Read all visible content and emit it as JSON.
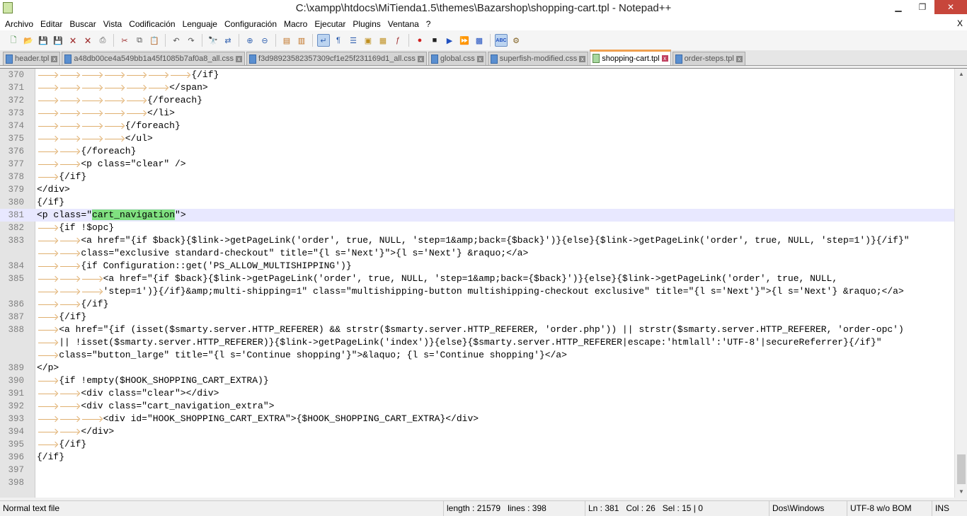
{
  "window": {
    "title": "C:\\xampp\\htdocs\\MiTienda1.5\\themes\\Bazarshop\\shopping-cart.tpl - Notepad++",
    "minimize": "▁",
    "maximize": "❐",
    "close": "✕"
  },
  "menu": [
    "Archivo",
    "Editar",
    "Buscar",
    "Vista",
    "Codificación",
    "Lenguaje",
    "Configuración",
    "Macro",
    "Ejecutar",
    "Plugins",
    "Ventana",
    "?"
  ],
  "menu_close": "X",
  "toolbar": [
    {
      "name": "new-file",
      "glyph": "🗋",
      "color": "#2a7a2a"
    },
    {
      "name": "open-file",
      "glyph": "📂",
      "color": "#c09020"
    },
    {
      "name": "save",
      "glyph": "💾",
      "color": "#3050a0"
    },
    {
      "name": "save-all",
      "glyph": "💾",
      "color": "#3050a0"
    },
    {
      "name": "close",
      "glyph": "🗙",
      "color": "#a03030"
    },
    {
      "name": "close-all",
      "glyph": "🗙",
      "color": "#a03030"
    },
    {
      "name": "print",
      "glyph": "⎙",
      "color": "#555"
    },
    {
      "sep": true
    },
    {
      "name": "cut",
      "glyph": "✂",
      "color": "#a03030"
    },
    {
      "name": "copy",
      "glyph": "⧉",
      "color": "#555"
    },
    {
      "name": "paste",
      "glyph": "📋",
      "color": "#555"
    },
    {
      "sep": true
    },
    {
      "name": "undo",
      "glyph": "↶",
      "color": "#555"
    },
    {
      "name": "redo",
      "glyph": "↷",
      "color": "#555"
    },
    {
      "sep": true
    },
    {
      "name": "find",
      "glyph": "🔭",
      "color": "#333"
    },
    {
      "name": "replace",
      "glyph": "⇄",
      "color": "#3060b0"
    },
    {
      "sep": true
    },
    {
      "name": "zoom-in",
      "glyph": "⊕",
      "color": "#3060b0"
    },
    {
      "name": "zoom-out",
      "glyph": "⊖",
      "color": "#3060b0"
    },
    {
      "sep": true
    },
    {
      "name": "sync-vertical",
      "glyph": "▤",
      "color": "#c07020"
    },
    {
      "name": "sync-horizontal",
      "glyph": "▥",
      "color": "#c07020"
    },
    {
      "sep": true
    },
    {
      "name": "word-wrap",
      "glyph": "↵",
      "color": "#3060b0",
      "active": true
    },
    {
      "name": "show-all-chars",
      "glyph": "¶",
      "color": "#3060b0"
    },
    {
      "name": "indent-guide",
      "glyph": "☰",
      "color": "#3060b0"
    },
    {
      "name": "define-language",
      "glyph": "▣",
      "color": "#c09020"
    },
    {
      "name": "doc-map",
      "glyph": "▦",
      "color": "#c09020"
    },
    {
      "name": "function-list",
      "glyph": "ƒ",
      "color": "#a03030"
    },
    {
      "sep": true
    },
    {
      "name": "record-macro",
      "glyph": "●",
      "color": "#d02020"
    },
    {
      "name": "stop-record",
      "glyph": "■",
      "color": "#222"
    },
    {
      "name": "play-macro",
      "glyph": "▶",
      "color": "#2050c0"
    },
    {
      "name": "run-macro-multiple",
      "glyph": "⏩",
      "color": "#2050c0"
    },
    {
      "name": "save-macro",
      "glyph": "▩",
      "color": "#2050c0"
    },
    {
      "sep": true
    },
    {
      "name": "spell-check",
      "glyph": "ABC",
      "color": "#2050c0",
      "active": true
    },
    {
      "name": "spell-options",
      "glyph": "⚙",
      "color": "#806020"
    }
  ],
  "tabs": [
    {
      "label": "header.tpl",
      "active": false
    },
    {
      "label": "a48db00ce4a549bb1a45f1085b7af0a8_all.css",
      "active": false
    },
    {
      "label": "f3d98923582357309cf1e25f231169d1_all.css",
      "active": false
    },
    {
      "label": "global.css",
      "active": false
    },
    {
      "label": "superfish-modified.css",
      "active": false
    },
    {
      "label": "shopping-cart.tpl",
      "active": true
    },
    {
      "label": "order-steps.tpl",
      "active": false
    }
  ],
  "code": [
    {
      "n": "370",
      "indent": 7,
      "text": "{/if}"
    },
    {
      "n": "371",
      "indent": 6,
      "text": "</span>"
    },
    {
      "n": "372",
      "indent": 5,
      "text": "{/foreach}"
    },
    {
      "n": "373",
      "indent": 5,
      "text": "</li>"
    },
    {
      "n": "374",
      "indent": 4,
      "text": "{/foreach}"
    },
    {
      "n": "375",
      "indent": 4,
      "text": "</ul>"
    },
    {
      "n": "376",
      "indent": 2,
      "text": "{/foreach}"
    },
    {
      "n": "377",
      "indent": 2,
      "text": "<p class=\"clear\" />"
    },
    {
      "n": "378",
      "indent": 1,
      "text": "{/if}"
    },
    {
      "n": "379",
      "indent": 0,
      "text": "</div>"
    },
    {
      "n": "380",
      "indent": 0,
      "text": "{/if}"
    },
    {
      "n": "381",
      "indent": 0,
      "text": "<p class=\"",
      "sel": "cart_navigation",
      "after": "\">",
      "current": true
    },
    {
      "n": "382",
      "indent": 1,
      "text": "{if !$opc}"
    },
    {
      "n": "383",
      "indent": 2,
      "text": "<a href=\"{if $back}{$link->getPageLink('order', true, NULL, 'step=1&amp;back={$back}')}{else}{$link->getPageLink('order', true, NULL, 'step=1')}{/if}\"",
      "cont": [
        "class=\"exclusive standard-checkout\" title=\"{l s='Next'}\">{l s='Next'} &raquo;</a>"
      ]
    },
    {
      "n": "384",
      "indent": 2,
      "text": "{if Configuration::get('PS_ALLOW_MULTISHIPPING')}"
    },
    {
      "n": "385",
      "indent": 3,
      "text": "<a href=\"{if $back}{$link->getPageLink('order', true, NULL, 'step=1&amp;back={$back}')}{else}{$link->getPageLink('order', true, NULL,",
      "cont": [
        "'step=1')}{/if}&amp;multi-shipping=1\" class=\"multishipping-button multishipping-checkout exclusive\" title=\"{l s='Next'}\">{l s='Next'} &raquo;</a>"
      ]
    },
    {
      "n": "386",
      "indent": 2,
      "text": "{/if}"
    },
    {
      "n": "387",
      "indent": 1,
      "text": "{/if}"
    },
    {
      "n": "388",
      "indent": 1,
      "text": "<a href=\"{if (isset($smarty.server.HTTP_REFERER) && strstr($smarty.server.HTTP_REFERER, 'order.php')) || strstr($smarty.server.HTTP_REFERER, 'order-opc')",
      "cont": [
        "|| !isset($smarty.server.HTTP_REFERER)}{$link->getPageLink('index')}{else}{$smarty.server.HTTP_REFERER|escape:'htmlall':'UTF-8'|secureReferrer}{/if}\"",
        "class=\"button_large\" title=\"{l s='Continue shopping'}\">&laquo; {l s='Continue shopping'}</a>"
      ]
    },
    {
      "n": "389",
      "indent": 0,
      "text": "</p>"
    },
    {
      "n": "390",
      "indent": 1,
      "text": "{if !empty($HOOK_SHOPPING_CART_EXTRA)}"
    },
    {
      "n": "391",
      "indent": 2,
      "text": "<div class=\"clear\"></div>"
    },
    {
      "n": "392",
      "indent": 2,
      "text": "<div class=\"cart_navigation_extra\">"
    },
    {
      "n": "393",
      "indent": 3,
      "text": "<div id=\"HOOK_SHOPPING_CART_EXTRA\">{$HOOK_SHOPPING_CART_EXTRA}</div>"
    },
    {
      "n": "394",
      "indent": 2,
      "text": "</div>"
    },
    {
      "n": "395",
      "indent": 1,
      "text": "{/if}"
    },
    {
      "n": "396",
      "indent": 0,
      "text": "{/if}"
    },
    {
      "n": "397",
      "indent": 0,
      "text": ""
    },
    {
      "n": "398",
      "indent": 0,
      "text": ""
    }
  ],
  "status": {
    "type": "Normal text file",
    "length": "length : 21579",
    "lines": "lines : 398",
    "ln": "Ln : 381",
    "col": "Col : 26",
    "sel": "Sel : 15 | 0",
    "eol": "Dos\\Windows",
    "encoding": "UTF-8 w/o BOM",
    "mode": "INS"
  }
}
